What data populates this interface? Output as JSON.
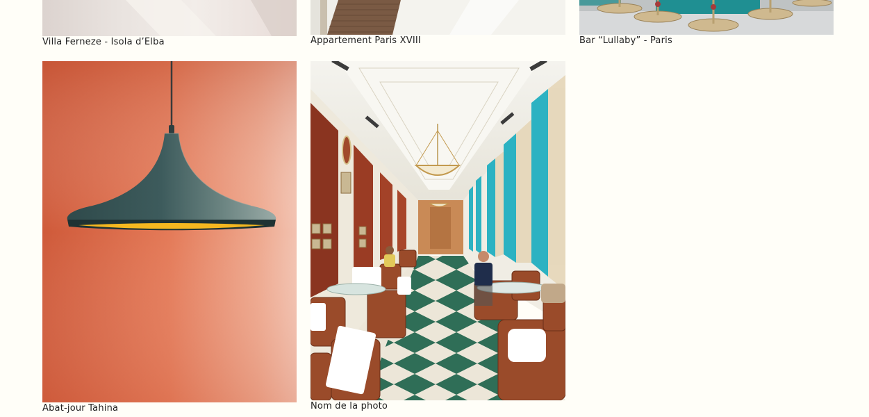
{
  "gallery": {
    "items": [
      {
        "caption": "Villa Ferneze - Isola d’Elba"
      },
      {
        "caption": "Appartement Paris XVIII"
      },
      {
        "caption": "Bar “Lullaby” - Paris"
      },
      {
        "caption": "Abat-jour Tahina"
      },
      {
        "caption": "Nom de la photo"
      }
    ]
  }
}
